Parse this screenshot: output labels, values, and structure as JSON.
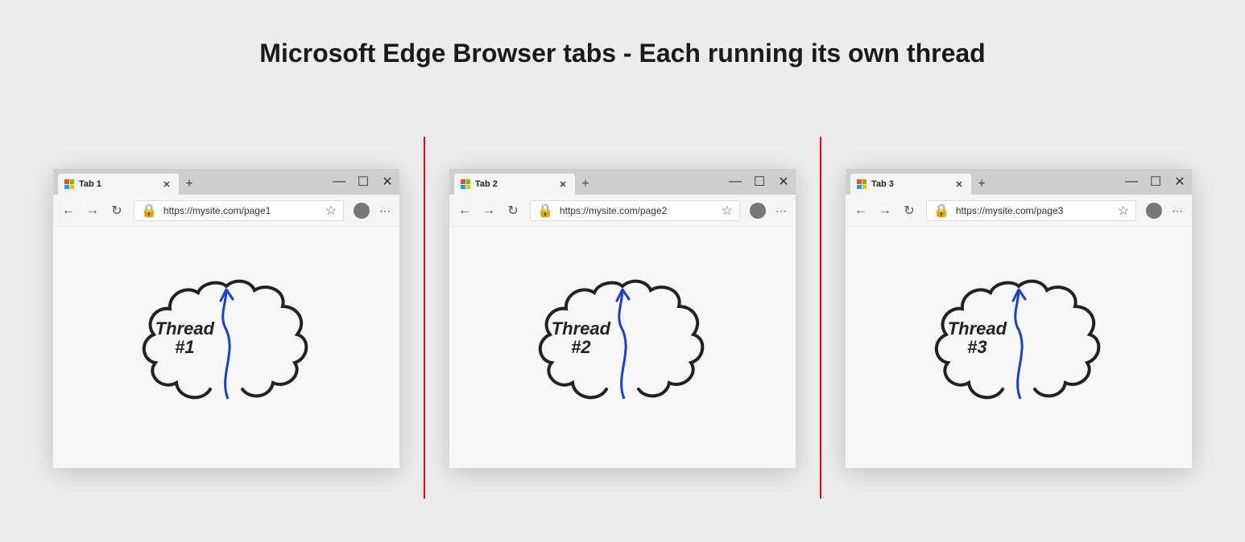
{
  "title": "Microsoft Edge Browser tabs - Each running its own thread",
  "browsers": [
    {
      "tab": "Tab 1",
      "url": "https://mysite.com/page1",
      "thread_label": "Thread\n#1"
    },
    {
      "tab": "Tab 2",
      "url": "https://mysite.com/page2",
      "thread_label": "Thread\n#2"
    },
    {
      "tab": "Tab 3",
      "url": "https://mysite.com/page3",
      "thread_label": "Thread\n#3"
    }
  ],
  "icons": {
    "close_x": "✕",
    "plus": "+",
    "minimize": "—",
    "maximize": "☐",
    "win_close": "✕",
    "back": "←",
    "forward": "→",
    "refresh": "↻",
    "lock": "🔒",
    "star": "☆",
    "more": "⋯"
  }
}
